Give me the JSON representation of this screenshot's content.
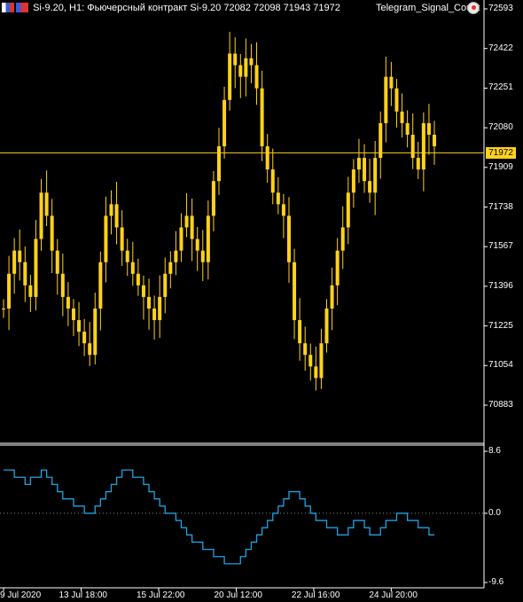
{
  "header": {
    "symbol": "Si-9.20, H1:",
    "instrument": "Фьючерсный контракт Si-9.20",
    "ohlc": "72082 72098 71943 71972",
    "indicator": "Telegram_Signal_Count"
  },
  "icons": {
    "flags": "flag-icons",
    "indicator": "telegram-indicator-icon"
  },
  "colors": {
    "candle": "#ffd21a",
    "oscillator": "#1fa3e0",
    "price_line": "#ffd21a",
    "background": "#000000"
  },
  "current_price": "71972",
  "price_axis": [
    "72593",
    "72422",
    "72251",
    "72080",
    "71909",
    "71738",
    "71567",
    "71396",
    "71225",
    "71054",
    "70883"
  ],
  "osc_axis": [
    "8.6",
    "0.0",
    "-9.6"
  ],
  "time_axis": [
    "9 Jul 2020",
    "13 Jul 18:00",
    "15 Jul 22:00",
    "20 Jul 12:00",
    "22 Jul 16:00",
    "24 Jul 20:00"
  ],
  "chart_data": {
    "type": "line",
    "title": "Si-9.20, H1",
    "price_series": {
      "name": "Si-9.20",
      "ylim": [
        70883,
        72593
      ],
      "values": [
        71300,
        71450,
        71550,
        71500,
        71400,
        71350,
        71600,
        71800,
        71700,
        71550,
        71450,
        71350,
        71300,
        71250,
        71200,
        71150,
        71100,
        71300,
        71500,
        71700,
        71750,
        71650,
        71550,
        71500,
        71450,
        71400,
        71350,
        71300,
        71250,
        71350,
        71450,
        71500,
        71550,
        71650,
        71700,
        71600,
        71550,
        71500,
        71700,
        71850,
        72000,
        72200,
        72400,
        72350,
        72300,
        72380,
        72350,
        72250,
        72000,
        71900,
        71800,
        71750,
        71700,
        71500,
        71250,
        71150,
        71100,
        71050,
        71000,
        71150,
        71300,
        71400,
        71550,
        71650,
        71800,
        71900,
        71950,
        71850,
        71800,
        71950,
        72100,
        72300,
        72250,
        72150,
        72100,
        72050,
        71950,
        71900,
        72100,
        72050,
        72000
      ],
      "last": 71972
    },
    "oscillator": {
      "name": "Telegram_Signal_Count",
      "ylim": [
        -9.6,
        8.6
      ],
      "values": [
        6,
        6,
        5,
        5,
        4,
        5,
        5,
        6,
        5,
        4,
        3,
        2,
        2,
        1,
        1,
        0,
        0,
        1,
        2,
        3,
        4,
        5,
        6,
        6,
        5,
        5,
        4,
        3,
        2,
        1,
        0,
        0,
        -1,
        -2,
        -3,
        -4,
        -4,
        -5,
        -5,
        -6,
        -6,
        -7,
        -7,
        -7,
        -6,
        -5,
        -4,
        -3,
        -2,
        -1,
        0,
        1,
        2,
        3,
        3,
        2,
        1,
        0,
        -1,
        -1,
        -2,
        -2,
        -3,
        -3,
        -2,
        -1,
        -1,
        -2,
        -3,
        -3,
        -2,
        -1,
        -1,
        0,
        0,
        -1,
        -1,
        -2,
        -2,
        -3,
        -3
      ],
      "zero_line": 0.0
    },
    "xlabels": [
      "9 Jul 2020",
      "13 Jul 18:00",
      "15 Jul 22:00",
      "20 Jul 12:00",
      "22 Jul 16:00",
      "24 Jul 20:00"
    ]
  }
}
